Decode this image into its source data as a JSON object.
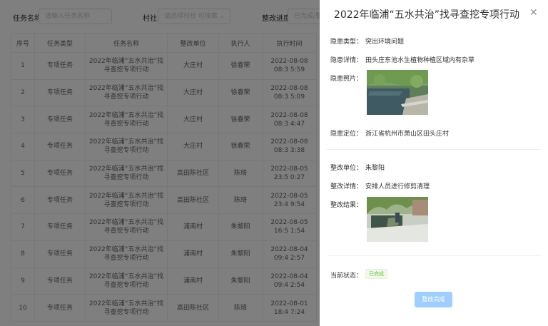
{
  "filters": {
    "task_name_label": "任务名称",
    "task_name_placeholder": "请输入任务名称",
    "village_label": "村社",
    "village_placeholder": "请选择村社 可搜索",
    "progress_label": "整改进度",
    "progress_placeholder": "已完成/整改"
  },
  "table": {
    "headers": [
      "序号",
      "任务类型",
      "任务名称",
      "整改单位",
      "执行人",
      "执行时间"
    ],
    "rows": [
      {
        "no": "1",
        "type": "专项任务",
        "name": "2022年临浦“五水共治”找寻查挖专项行动",
        "unit": "大庄村",
        "person": "徐春荣",
        "time": "2022-08-08 08:3 5:59"
      },
      {
        "no": "2",
        "type": "专项任务",
        "name": "2022年临浦“五水共治”找寻查挖专项行动",
        "unit": "大庄村",
        "person": "徐春荣",
        "time": "2022-08-08 08:3 5:09"
      },
      {
        "no": "3",
        "type": "专项任务",
        "name": "2022年临浦“五水共治”找寻查挖专项行动",
        "unit": "大庄村",
        "person": "徐春荣",
        "time": "2022-08-08 08:3 4:47"
      },
      {
        "no": "4",
        "type": "专项任务",
        "name": "2022年临浦“五水共治”找寻查挖专项行动",
        "unit": "大庄村",
        "person": "徐春荣",
        "time": "2022-08-08 08:3 3:38"
      },
      {
        "no": "5",
        "type": "专项任务",
        "name": "2022年临浦“五水共治”找寻查挖专项行动",
        "unit": "高田陈社区",
        "person": "陈琦",
        "time": "2022-08-05 23:5 0:27"
      },
      {
        "no": "6",
        "type": "专项任务",
        "name": "2022年临浦“五水共治”找寻查挖专项行动",
        "unit": "高田陈社区",
        "person": "陈琦",
        "time": "2022-08-05 23:4 9:54"
      },
      {
        "no": "7",
        "type": "专项任务",
        "name": "2022年临浦“五水共治”找寻查挖专项行动",
        "unit": "浦南村",
        "person": "朱黎阳",
        "time": "2022-08-05 16:5 1:54"
      },
      {
        "no": "8",
        "type": "专项任务",
        "name": "2022年临浦“五水共治”找寻查挖专项行动",
        "unit": "浦南村",
        "person": "朱黎阳",
        "time": "2022-08-04 09:4 2:57"
      },
      {
        "no": "9",
        "type": "专项任务",
        "name": "2022年临浦“五水共治”找寻查挖专项行动",
        "unit": "浦南村",
        "person": "朱黎阳",
        "time": "2022-08-04 09:4 2:54"
      },
      {
        "no": "10",
        "type": "专项任务",
        "name": "2022年临浦“五水共治”找寻查挖专项行动",
        "unit": "高田陈社区",
        "person": "陈琦",
        "time": "2022-08-01 18:4 7:24"
      }
    ]
  },
  "drawer": {
    "title": "2022年临浦“五水共治”找寻查挖专项行动",
    "close_icon": "close-icon",
    "hazard_type_label": "隐患类型：",
    "hazard_type_value": "突出环境问题",
    "hazard_detail_label": "隐患详情：",
    "hazard_detail_value": "田头庄东池水生植物种植区域内有杂草",
    "hazard_photo_label": "隐患照片：",
    "hazard_location_label": "隐患定位：",
    "hazard_location_value": "浙江省杭州市萧山区田头庄村",
    "rect_unit_label": "整改单位：",
    "rect_unit_value": "朱黎阳",
    "rect_detail_label": "整改详情：",
    "rect_detail_value": "安排人员进行修剪清理",
    "rect_result_label": "整改结果：",
    "status_label": "当前状态：",
    "status_value": "已完成",
    "submit_button": "整改完成"
  },
  "colors": {
    "primary_disabled": "#a0cfff",
    "success": "#67c23a",
    "mask": "rgba(0,0,0,0.5)"
  }
}
